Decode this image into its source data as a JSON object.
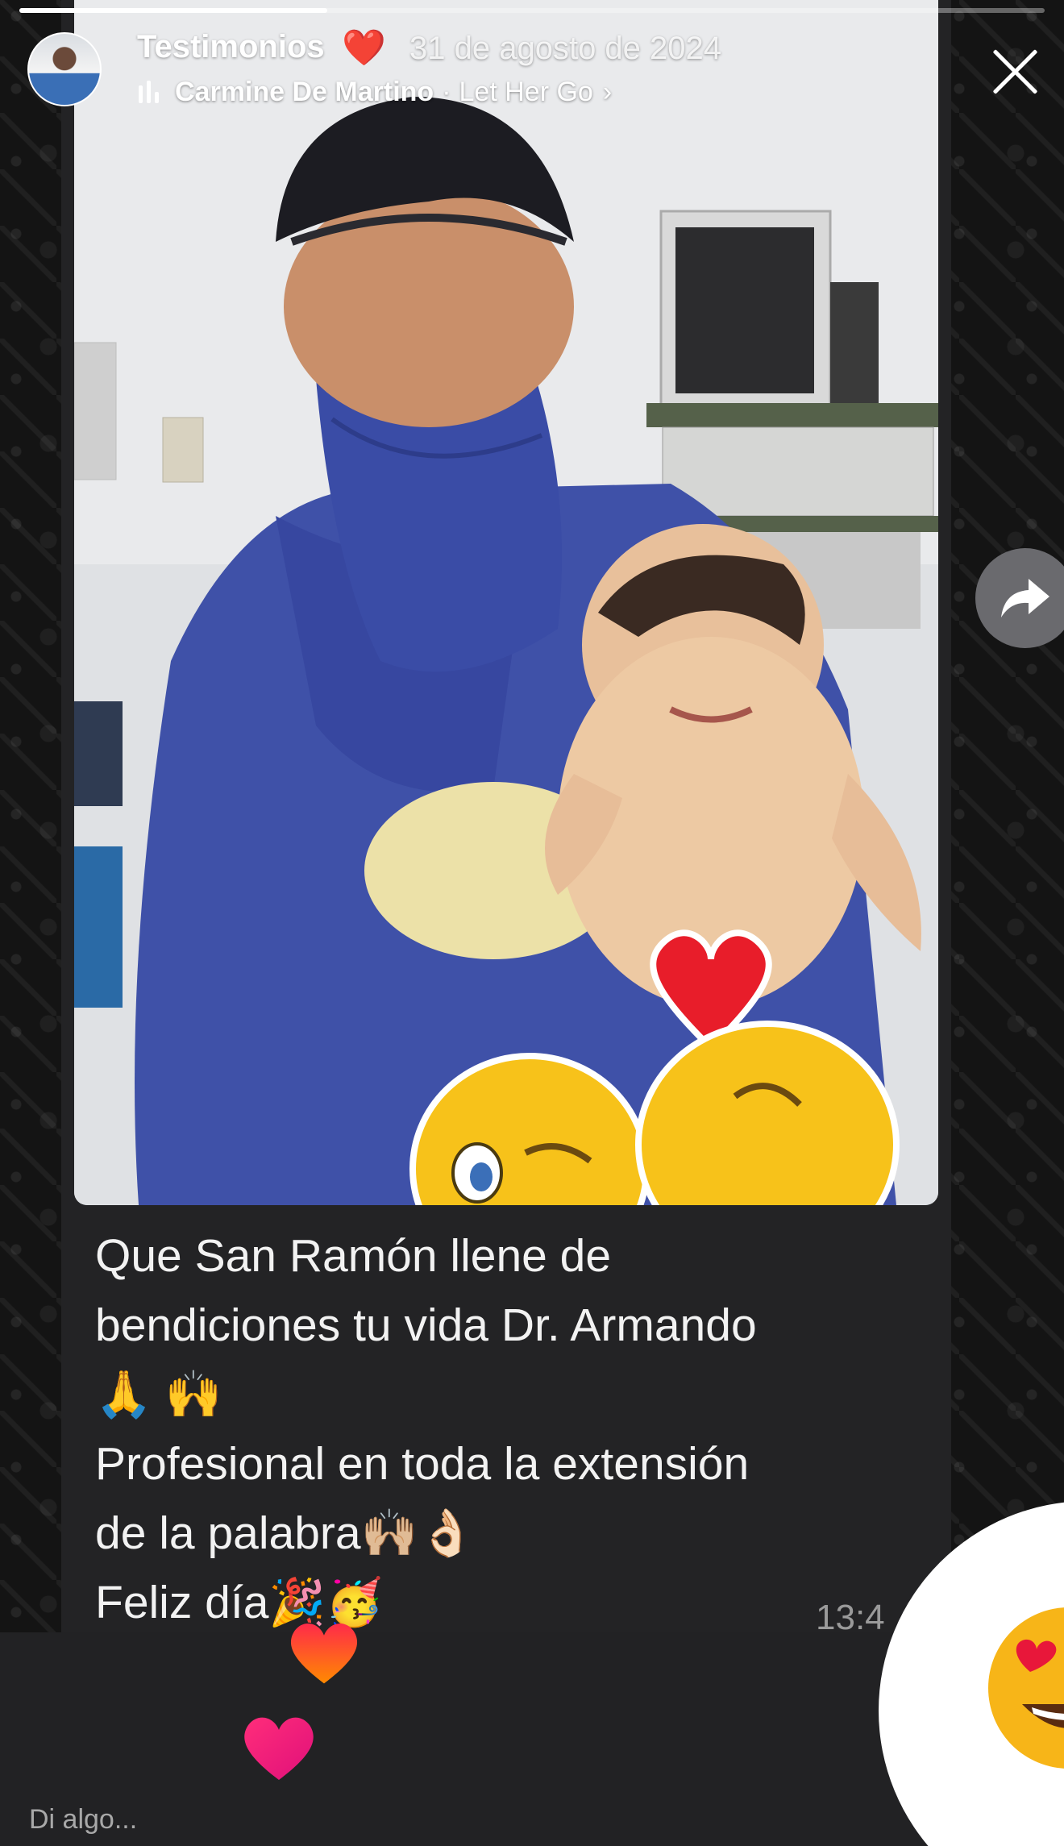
{
  "story": {
    "title": "Testimonios",
    "heart": "❤️",
    "date": "31 de agosto de 2024",
    "progress": 0.3,
    "music": {
      "artist": "Carmine De Martino",
      "separator": "·",
      "song": "Let Her Go",
      "chevron": "›"
    }
  },
  "message": {
    "lines": [
      "Que San Ramón llene de",
      "bendiciones tu vida Dr. Armando",
      "🙏 🙌",
      "Profesional en toda la extensión",
      "de la palabra🙌🏼👌🏻",
      "Feliz día🎉🥳"
    ],
    "time": "13:4"
  },
  "reply": {
    "placeholder": "Di algo..."
  },
  "icons": {
    "close": "close-icon",
    "share": "share-arrow-icon",
    "music": "music-bars-icon",
    "reaction": "heart-eyes-emoji"
  },
  "colors": {
    "bubble": "#232325",
    "scrub_blue": "#3f51a8",
    "heart_red": "#e0141e",
    "heart_pink": "#ff2d7a"
  }
}
